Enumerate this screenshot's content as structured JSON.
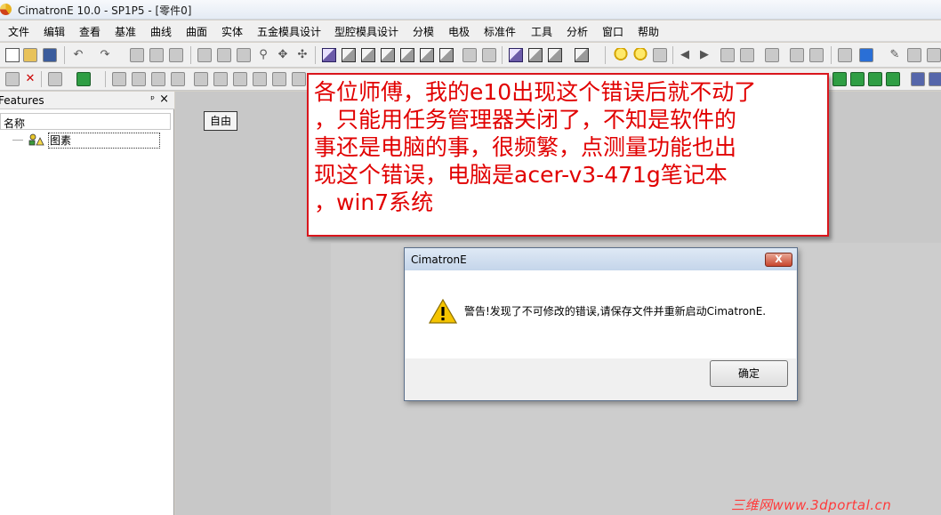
{
  "window": {
    "title": "CimatronE 10.0 - SP1P5 - [零件0]",
    "logo": "cimatron-logo-icon"
  },
  "menubar": {
    "items": [
      "文件",
      "编辑",
      "查看",
      "基准",
      "曲线",
      "曲面",
      "实体",
      "五金模具设计",
      "型腔模具设计",
      "分模",
      "电极",
      "标准件",
      "工具",
      "分析",
      "窗口",
      "帮助"
    ]
  },
  "features_panel": {
    "title": "Features",
    "pin_glyph": "ᵖ",
    "close_glyph": "×",
    "column_header": "名称",
    "tree": [
      {
        "label": "图素",
        "icon": "features-tree-icon"
      }
    ]
  },
  "graphics": {
    "mode_label": "自由"
  },
  "annotation": {
    "lines": [
      "各位师傅，我的e10出现这个错误后就不动了",
      "，只能用任务管理器关闭了，不知是软件的",
      "事还是电脑的事，很频繁，点测量功能也出",
      "现这个错误，电脑是acer-v3-471g笔记本",
      "，win7系统"
    ]
  },
  "dialog": {
    "title": "CimatronE",
    "close_glyph": "X",
    "message": "警告!发现了不可修改的错误,请保存文件并重新启动CimatronE.",
    "ok_label": "确定",
    "icon": "warning-icon"
  },
  "watermark": "三维网www.3dportal.cn",
  "colors": {
    "annotation_red": "#e10000",
    "annotation_border": "#d9161c",
    "watermark": "#ff3b3b"
  }
}
